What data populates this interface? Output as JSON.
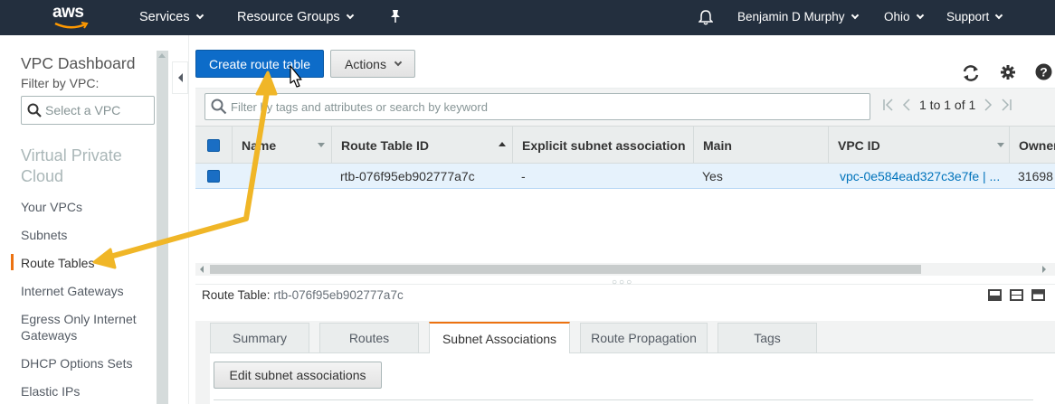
{
  "topnav": {
    "logo": "aws",
    "services": "Services",
    "resource_groups": "Resource Groups",
    "user": "Benjamin D Murphy",
    "region": "Ohio",
    "support": "Support"
  },
  "sidebar": {
    "title": "VPC Dashboard",
    "filter_label": "Filter by VPC:",
    "select_placeholder": "Select a VPC",
    "section": "Virtual Private Cloud",
    "items": [
      {
        "label": "Your VPCs"
      },
      {
        "label": "Subnets"
      },
      {
        "label": "Route Tables",
        "active": true
      },
      {
        "label": "Internet Gateways"
      },
      {
        "label": "Egress Only Internet Gateways"
      },
      {
        "label": "DHCP Options Sets"
      },
      {
        "label": "Elastic IPs"
      }
    ]
  },
  "toolbar": {
    "create_label": "Create route table",
    "actions_label": "Actions"
  },
  "search": {
    "placeholder": "Filter by tags and attributes or search by keyword"
  },
  "pagination": {
    "text": "1 to 1 of 1"
  },
  "table": {
    "columns": [
      "Name",
      "Route Table ID",
      "Explicit subnet association",
      "Main",
      "VPC ID",
      "Owner"
    ],
    "rows": [
      {
        "name": "",
        "route_table_id": "rtb-076f95eb902777a7c",
        "explicit_subnet_association": "-",
        "main": "Yes",
        "vpc_id": "vpc-0e584ead327c3e7fe | ...",
        "owner": "31698"
      }
    ]
  },
  "detail": {
    "label": "Route Table:",
    "value": "rtb-076f95eb902777a7c"
  },
  "tabs": [
    {
      "label": "Summary"
    },
    {
      "label": "Routes"
    },
    {
      "label": "Subnet Associations",
      "active": true
    },
    {
      "label": "Route Propagation"
    },
    {
      "label": "Tags"
    }
  ],
  "tab_content": {
    "edit_button": "Edit subnet associations"
  },
  "colors": {
    "nav_bg": "#232f3e",
    "primary": "#0d6cc9",
    "accent": "#ec7211",
    "annotation_arrow": "#f0b627",
    "link": "#0073bb"
  },
  "icons": [
    "aws-logo",
    "bell-icon",
    "pin-icon",
    "search-icon",
    "refresh-icon",
    "gear-icon",
    "help-icon",
    "first-page-icon",
    "prev-page-icon",
    "next-page-icon",
    "last-page-icon",
    "mouse-cursor-icon"
  ]
}
